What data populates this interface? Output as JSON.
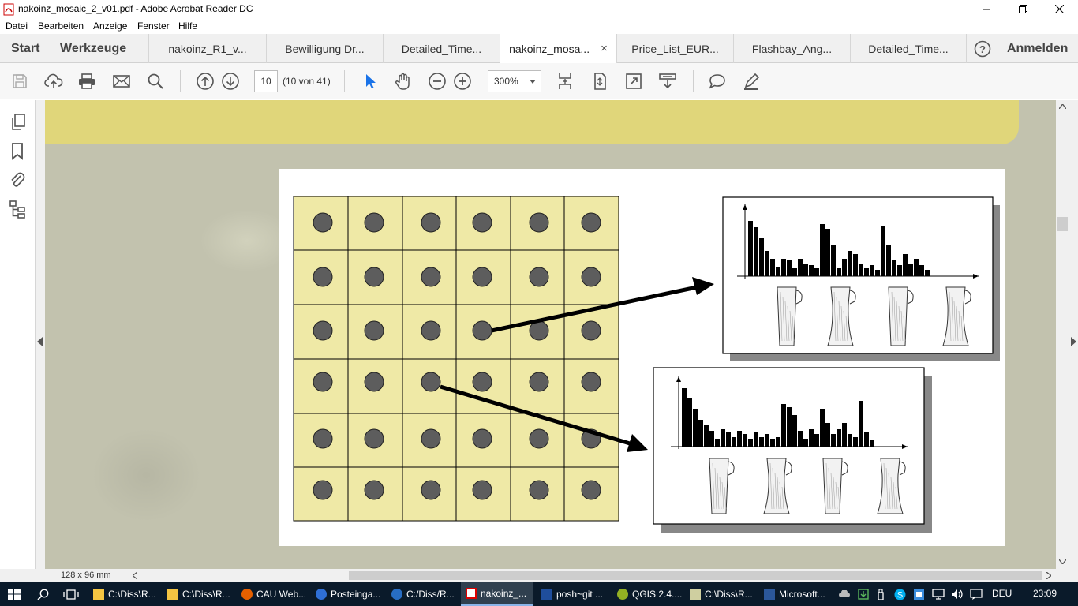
{
  "window": {
    "title": "nakoinz_mosaic_2_v01.pdf - Adobe Acrobat Reader DC"
  },
  "menu": [
    "Datei",
    "Bearbeiten",
    "Anzeige",
    "Fenster",
    "Hilfe"
  ],
  "nav": {
    "start": "Start",
    "tools": "Werkzeuge",
    "help_icon": "question-icon",
    "signin": "Anmelden"
  },
  "tabs": [
    {
      "label": "nakoinz_R1_v...",
      "active": false
    },
    {
      "label": "Bewilligung Dr...",
      "active": false
    },
    {
      "label": "Detailed_Time...",
      "active": false
    },
    {
      "label": "nakoinz_mosa...",
      "active": true,
      "close": "×"
    },
    {
      "label": "Price_List_EUR...",
      "active": false
    },
    {
      "label": "Flashbay_Ang...",
      "active": false
    },
    {
      "label": "Detailed_Time...",
      "active": false
    }
  ],
  "toolbar": {
    "page_current": "10",
    "page_count": "(10 von 41)",
    "zoom": "300%"
  },
  "status": {
    "page_size": "128 x 96 mm"
  },
  "document": {
    "grid_rows": 6,
    "grid_cols": 6,
    "cell_color": "#efe9a6",
    "dot_color": "#5d5d5d",
    "histogram_a": [
      70,
      62,
      48,
      32,
      22,
      12,
      22,
      20,
      10,
      22,
      16,
      14,
      10,
      66,
      60,
      40,
      10,
      22,
      32,
      28,
      16,
      10,
      14,
      8,
      64,
      40,
      20,
      14,
      28,
      16,
      22,
      14,
      8
    ],
    "histogram_b": [
      74,
      62,
      48,
      34,
      28,
      20,
      10,
      22,
      18,
      12,
      20,
      16,
      10,
      18,
      12,
      16,
      10,
      12,
      54,
      50,
      40,
      20,
      10,
      22,
      16,
      48,
      30,
      16,
      22,
      30,
      16,
      12,
      58,
      18,
      8
    ]
  },
  "taskbar": {
    "items": [
      {
        "label": "C:\\Diss\\R...",
        "icon": "folder-icon",
        "active": false
      },
      {
        "label": "C:\\Diss\\R...",
        "icon": "folder-icon",
        "active": false
      },
      {
        "label": "CAU Web...",
        "icon": "firefox-icon",
        "active": false
      },
      {
        "label": "Posteinga...",
        "icon": "mail-icon",
        "active": false
      },
      {
        "label": "C:/Diss/R...",
        "icon": "r-icon",
        "active": false
      },
      {
        "label": "nakoinz_...",
        "icon": "pdf-icon",
        "active": true
      },
      {
        "label": "posh~git ...",
        "icon": "powershell-icon",
        "active": false
      },
      {
        "label": "QGIS 2.4....",
        "icon": "qgis-icon",
        "active": false
      },
      {
        "label": "C:\\Diss\\R...",
        "icon": "notepad-icon",
        "active": false
      },
      {
        "label": "Microsoft...",
        "icon": "word-icon",
        "active": false
      }
    ],
    "lang": "DEU",
    "clock": "23:09"
  }
}
